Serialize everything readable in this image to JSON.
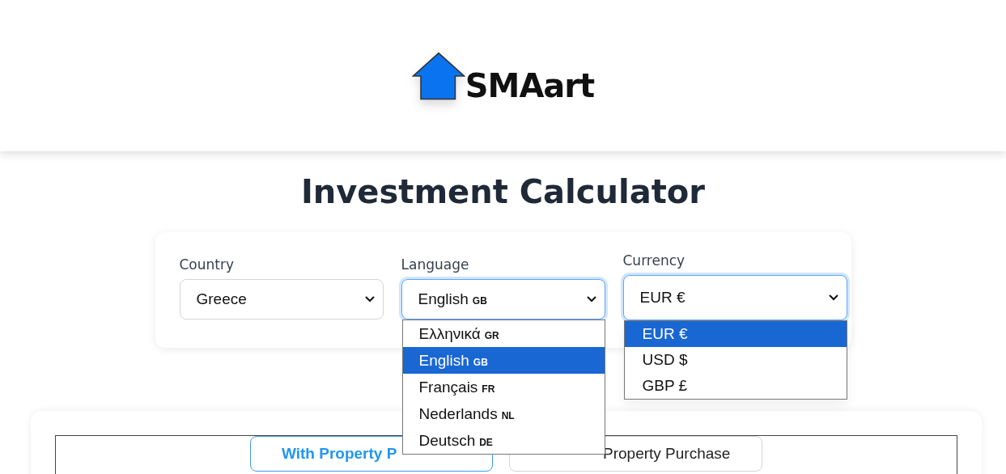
{
  "logo": {
    "text": "SMAart"
  },
  "title": "Investment Calculator",
  "fields": [
    {
      "label": "Country",
      "value": "Greece",
      "focused": false
    },
    {
      "label": "Language",
      "value": "English",
      "code": "GB",
      "focused": true,
      "options": [
        {
          "label": "Ελληνικά",
          "code": "GR",
          "selected": false
        },
        {
          "label": "English",
          "code": "GB",
          "selected": true
        },
        {
          "label": "Français",
          "code": "FR",
          "selected": false
        },
        {
          "label": "Nederlands",
          "code": "NL",
          "selected": false
        },
        {
          "label": "Deutsch",
          "code": "DE",
          "selected": false
        }
      ]
    },
    {
      "label": "Currency",
      "value": "EUR €",
      "focused": true,
      "options": [
        {
          "label": "EUR €",
          "selected": true
        },
        {
          "label": "USD $",
          "selected": false
        },
        {
          "label": "GBP £",
          "selected": false
        }
      ]
    }
  ],
  "tabs": [
    {
      "label": "With Property P",
      "selected": true
    },
    {
      "label": "Property Purchase",
      "selected": false
    }
  ]
}
